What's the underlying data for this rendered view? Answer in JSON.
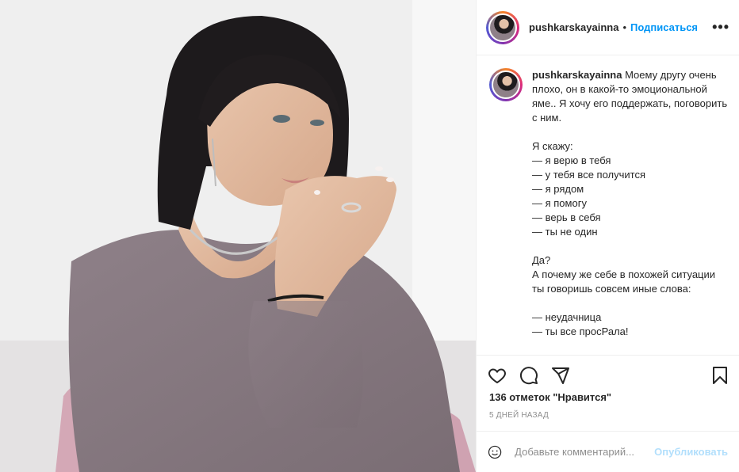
{
  "post": {
    "username": "pushkarskayainna",
    "separator": "•",
    "follow_label": "Подписаться",
    "more_label": "•••",
    "caption": "Моему другу очень плохо, он в какой-то эмоциональной яме.. Я хочу его поддержать, поговорить с ним.\n\nЯ скажу:\n— я верю в тебя\n— у тебя все получится\n— я рядом\n— я помогу\n— верь в себя\n— ты не один\n\nДа?\nА почему же себе в похожей ситуации ты говоришь совсем иные слова:\n\n— неудачница\n— ты все просРала!",
    "likes": "136 отметок \"Нравится\"",
    "time_ago": "5 ДНЕЙ НАЗАД"
  },
  "comment": {
    "placeholder": "Добавьте комментарий...",
    "publish_label": "Опубликовать"
  },
  "icons": {
    "like": "heart-icon",
    "comment": "comment-icon",
    "share": "share-icon",
    "save": "bookmark-icon",
    "emoji": "emoji-icon"
  },
  "colors": {
    "accent": "#0095f6",
    "publish_disabled": "#b2dffc",
    "muted": "#8e8e8e",
    "border": "#efefef"
  }
}
